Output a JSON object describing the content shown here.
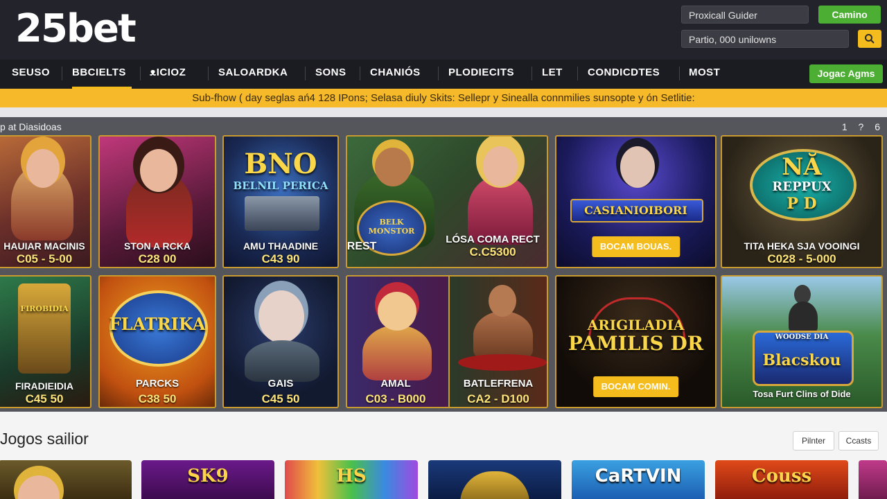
{
  "header": {
    "logo": "25bet",
    "input_top": "Proxicall Guider",
    "input_bottom": "Partio, 000 unilowns",
    "login_button": "Camino"
  },
  "nav": {
    "items": [
      "SEUSO",
      "BBCIELTS",
      "ᴥICIOZ",
      "SALOARDKA",
      "SONS",
      "CHANIÓS",
      "PLODIECITS",
      "LET",
      "CONDICDTES",
      "MOST"
    ],
    "cta_button": "Jogac Agms"
  },
  "ticker": {
    "text": "Sub-fhow ( day seglas ań4 128 IPons; Selasa diuly Skits: Sellepr y Sinealla connmilies sunsopte y ón Setlitie:"
  },
  "featured": {
    "title": "p at Diasidoas",
    "pager": "1 ? 6",
    "row1": [
      {
        "label": "HAUIAR MACINIS",
        "price": "C05 - 5-00"
      },
      {
        "label": "STON A RCKA",
        "price": "C28 00"
      },
      {
        "big": "BNO",
        "sub": "BELNIL PERICA",
        "label": "AMU THAADINE",
        "price": "C43 90"
      },
      {
        "badge": "BELK MONSTOR",
        "label": "PRO PIREST"
      },
      {
        "label": "LÓSA COMA RECT",
        "price": "C.C5300"
      },
      {
        "big": "CASIANIOIBORI",
        "button": "BOCAM BOUAS."
      },
      {
        "big": "NĂ",
        "sub": "REPPUX",
        "sub2": "P D",
        "label": "TITA HEKA SJA VOOINGI",
        "price": "C028 - 5-000"
      }
    ],
    "row2": [
      {
        "sub": "FIROBIDIA",
        "label": "FIRADIEIDIA",
        "price": "C45 50"
      },
      {
        "big": "FLATRIKA",
        "label": "PARCKS",
        "price": "C38 50"
      },
      {
        "label": "GAIS",
        "price": "C45 50"
      },
      {
        "label": "AMAL",
        "price": "C03 - B000"
      },
      {
        "label": "BATLEFRENA",
        "price": "CA2 - D100"
      },
      {
        "big": "ARIGILADIA",
        "sub": "PAMILIS DR",
        "button": "BOCAM COMIN."
      },
      {
        "sub": "WOODSE DIA",
        "big": "Blacskou",
        "label": "Tosa Furt Clins of Dide"
      }
    ]
  },
  "section": {
    "title": "Jogos sailior",
    "buttons": [
      "Pilnter",
      "Ccasts"
    ],
    "thumbs": [
      "",
      "SK9",
      "HS",
      "",
      "CaRTVIN",
      "Couss"
    ]
  },
  "colors": {
    "accent": "#f4bc1c",
    "green": "#4caf33",
    "header_bg": "#23242b"
  }
}
